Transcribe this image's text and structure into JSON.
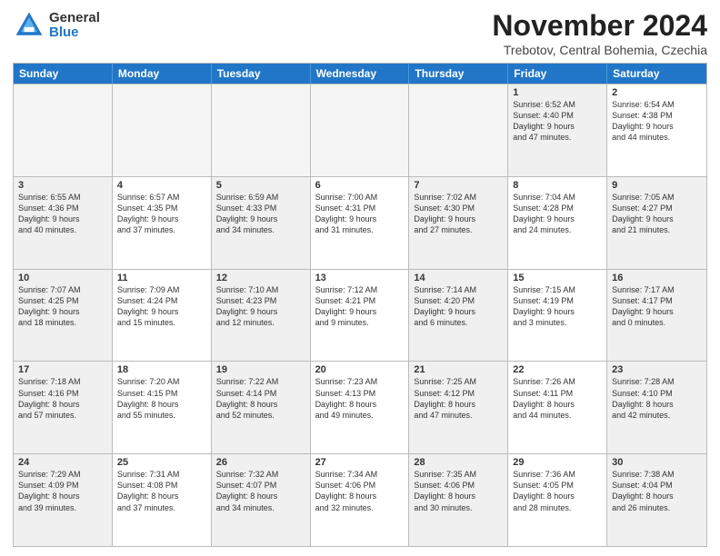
{
  "header": {
    "logo_general": "General",
    "logo_blue": "Blue",
    "title": "November 2024",
    "location": "Trebotov, Central Bohemia, Czechia"
  },
  "days_of_week": [
    "Sunday",
    "Monday",
    "Tuesday",
    "Wednesday",
    "Thursday",
    "Friday",
    "Saturday"
  ],
  "rows": [
    [
      {
        "day": "",
        "info": "",
        "empty": true
      },
      {
        "day": "",
        "info": "",
        "empty": true
      },
      {
        "day": "",
        "info": "",
        "empty": true
      },
      {
        "day": "",
        "info": "",
        "empty": true
      },
      {
        "day": "",
        "info": "",
        "empty": true
      },
      {
        "day": "1",
        "info": "Sunrise: 6:52 AM\nSunset: 4:40 PM\nDaylight: 9 hours\nand 47 minutes.",
        "shaded": true
      },
      {
        "day": "2",
        "info": "Sunrise: 6:54 AM\nSunset: 4:38 PM\nDaylight: 9 hours\nand 44 minutes.",
        "shaded": false
      }
    ],
    [
      {
        "day": "3",
        "info": "Sunrise: 6:55 AM\nSunset: 4:36 PM\nDaylight: 9 hours\nand 40 minutes.",
        "shaded": true
      },
      {
        "day": "4",
        "info": "Sunrise: 6:57 AM\nSunset: 4:35 PM\nDaylight: 9 hours\nand 37 minutes.",
        "shaded": false
      },
      {
        "day": "5",
        "info": "Sunrise: 6:59 AM\nSunset: 4:33 PM\nDaylight: 9 hours\nand 34 minutes.",
        "shaded": true
      },
      {
        "day": "6",
        "info": "Sunrise: 7:00 AM\nSunset: 4:31 PM\nDaylight: 9 hours\nand 31 minutes.",
        "shaded": false
      },
      {
        "day": "7",
        "info": "Sunrise: 7:02 AM\nSunset: 4:30 PM\nDaylight: 9 hours\nand 27 minutes.",
        "shaded": true
      },
      {
        "day": "8",
        "info": "Sunrise: 7:04 AM\nSunset: 4:28 PM\nDaylight: 9 hours\nand 24 minutes.",
        "shaded": false
      },
      {
        "day": "9",
        "info": "Sunrise: 7:05 AM\nSunset: 4:27 PM\nDaylight: 9 hours\nand 21 minutes.",
        "shaded": true
      }
    ],
    [
      {
        "day": "10",
        "info": "Sunrise: 7:07 AM\nSunset: 4:25 PM\nDaylight: 9 hours\nand 18 minutes.",
        "shaded": true
      },
      {
        "day": "11",
        "info": "Sunrise: 7:09 AM\nSunset: 4:24 PM\nDaylight: 9 hours\nand 15 minutes.",
        "shaded": false
      },
      {
        "day": "12",
        "info": "Sunrise: 7:10 AM\nSunset: 4:23 PM\nDaylight: 9 hours\nand 12 minutes.",
        "shaded": true
      },
      {
        "day": "13",
        "info": "Sunrise: 7:12 AM\nSunset: 4:21 PM\nDaylight: 9 hours\nand 9 minutes.",
        "shaded": false
      },
      {
        "day": "14",
        "info": "Sunrise: 7:14 AM\nSunset: 4:20 PM\nDaylight: 9 hours\nand 6 minutes.",
        "shaded": true
      },
      {
        "day": "15",
        "info": "Sunrise: 7:15 AM\nSunset: 4:19 PM\nDaylight: 9 hours\nand 3 minutes.",
        "shaded": false
      },
      {
        "day": "16",
        "info": "Sunrise: 7:17 AM\nSunset: 4:17 PM\nDaylight: 9 hours\nand 0 minutes.",
        "shaded": true
      }
    ],
    [
      {
        "day": "17",
        "info": "Sunrise: 7:18 AM\nSunset: 4:16 PM\nDaylight: 8 hours\nand 57 minutes.",
        "shaded": true
      },
      {
        "day": "18",
        "info": "Sunrise: 7:20 AM\nSunset: 4:15 PM\nDaylight: 8 hours\nand 55 minutes.",
        "shaded": false
      },
      {
        "day": "19",
        "info": "Sunrise: 7:22 AM\nSunset: 4:14 PM\nDaylight: 8 hours\nand 52 minutes.",
        "shaded": true
      },
      {
        "day": "20",
        "info": "Sunrise: 7:23 AM\nSunset: 4:13 PM\nDaylight: 8 hours\nand 49 minutes.",
        "shaded": false
      },
      {
        "day": "21",
        "info": "Sunrise: 7:25 AM\nSunset: 4:12 PM\nDaylight: 8 hours\nand 47 minutes.",
        "shaded": true
      },
      {
        "day": "22",
        "info": "Sunrise: 7:26 AM\nSunset: 4:11 PM\nDaylight: 8 hours\nand 44 minutes.",
        "shaded": false
      },
      {
        "day": "23",
        "info": "Sunrise: 7:28 AM\nSunset: 4:10 PM\nDaylight: 8 hours\nand 42 minutes.",
        "shaded": true
      }
    ],
    [
      {
        "day": "24",
        "info": "Sunrise: 7:29 AM\nSunset: 4:09 PM\nDaylight: 8 hours\nand 39 minutes.",
        "shaded": true
      },
      {
        "day": "25",
        "info": "Sunrise: 7:31 AM\nSunset: 4:08 PM\nDaylight: 8 hours\nand 37 minutes.",
        "shaded": false
      },
      {
        "day": "26",
        "info": "Sunrise: 7:32 AM\nSunset: 4:07 PM\nDaylight: 8 hours\nand 34 minutes.",
        "shaded": true
      },
      {
        "day": "27",
        "info": "Sunrise: 7:34 AM\nSunset: 4:06 PM\nDaylight: 8 hours\nand 32 minutes.",
        "shaded": false
      },
      {
        "day": "28",
        "info": "Sunrise: 7:35 AM\nSunset: 4:06 PM\nDaylight: 8 hours\nand 30 minutes.",
        "shaded": true
      },
      {
        "day": "29",
        "info": "Sunrise: 7:36 AM\nSunset: 4:05 PM\nDaylight: 8 hours\nand 28 minutes.",
        "shaded": false
      },
      {
        "day": "30",
        "info": "Sunrise: 7:38 AM\nSunset: 4:04 PM\nDaylight: 8 hours\nand 26 minutes.",
        "shaded": true
      }
    ]
  ]
}
